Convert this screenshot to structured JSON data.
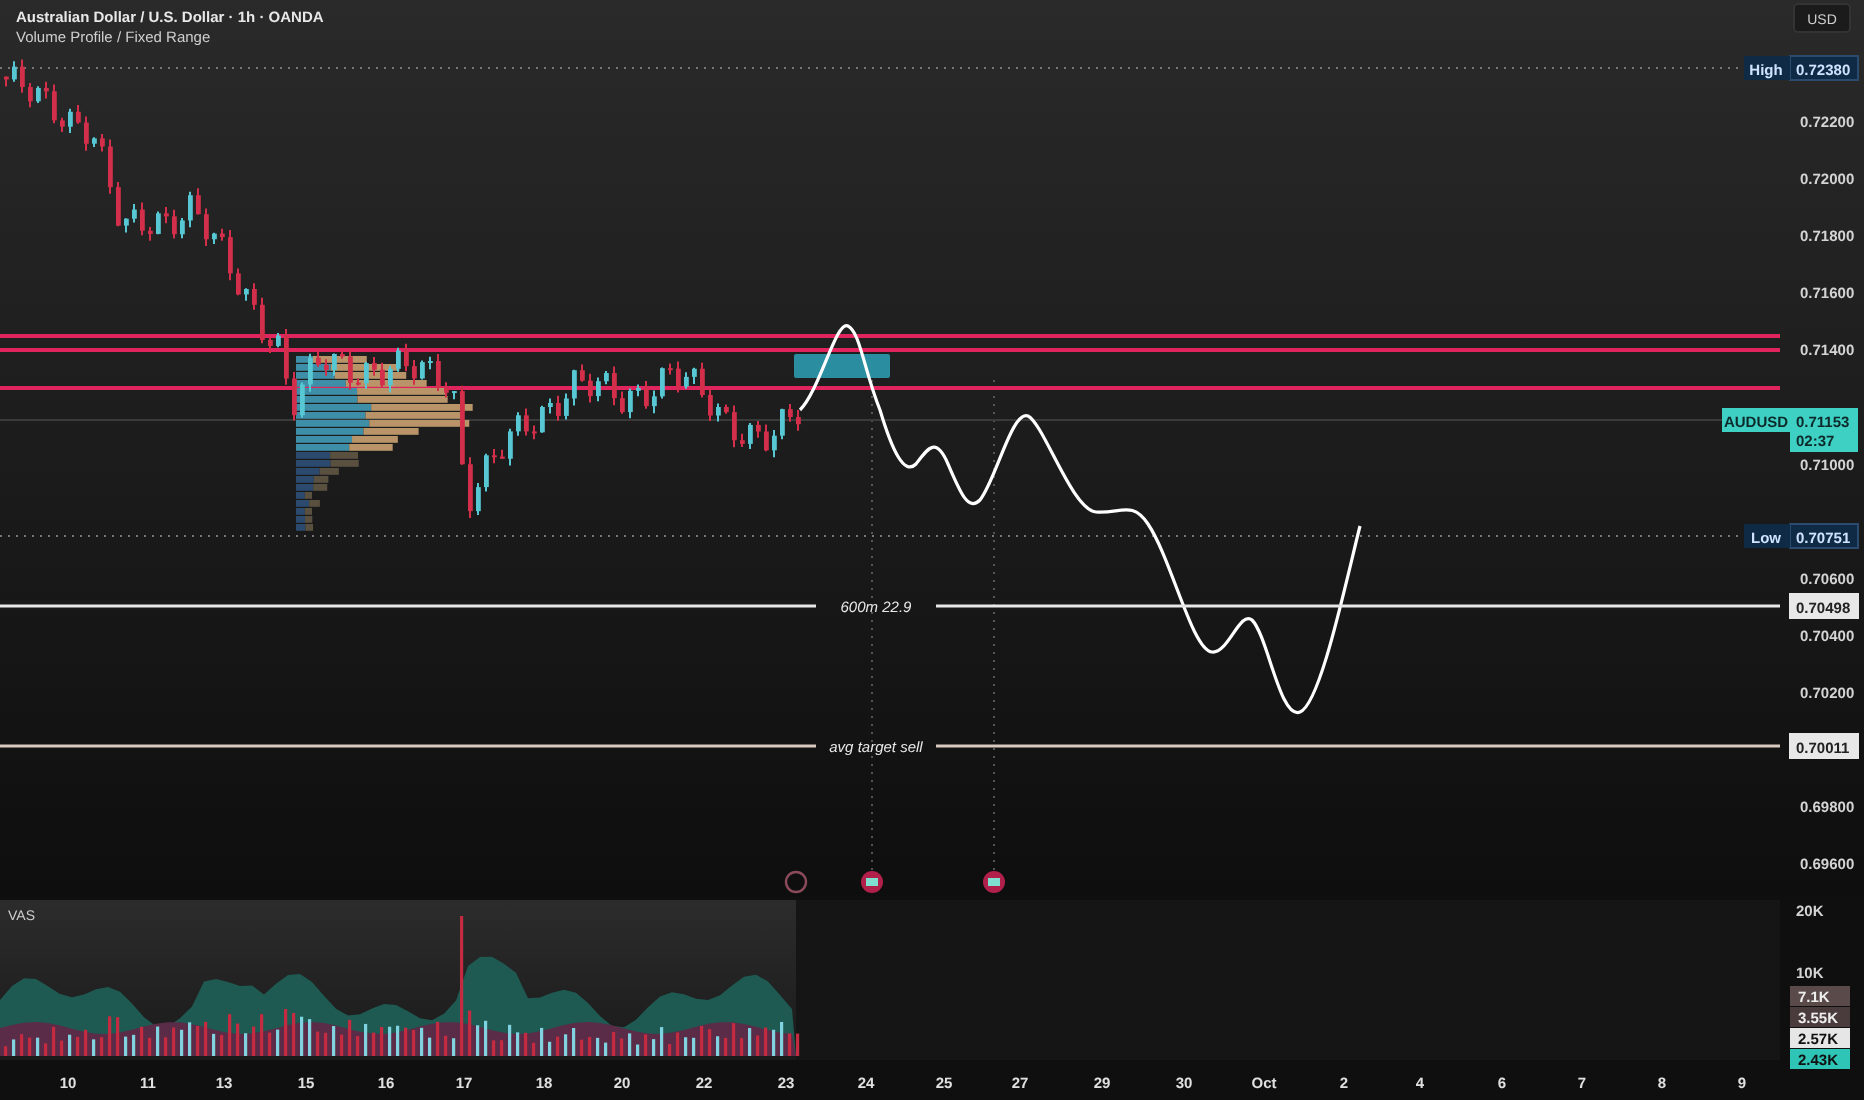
{
  "header": {
    "symbol_title": "Australian Dollar / U.S. Dollar · 1h · OANDA",
    "indicator": "Volume Profile / Fixed Range"
  },
  "currency_button": "USD",
  "price_scale": [
    "0.72200",
    "0.72000",
    "0.71800",
    "0.71600",
    "0.71400",
    "0.71000",
    "0.70600",
    "0.70400",
    "0.70200",
    "0.69800",
    "0.69600"
  ],
  "price_badges": [
    {
      "kind": "high",
      "caption": "High",
      "value": "0.72380"
    },
    {
      "kind": "last",
      "caption": "AUDUSD",
      "value": "0.71153",
      "countdown": "02:37"
    },
    {
      "kind": "low",
      "caption": "Low",
      "value": "0.70751"
    },
    {
      "kind": "line",
      "value": "0.70498"
    },
    {
      "kind": "line",
      "value": "0.70011"
    }
  ],
  "labeled_lines": [
    {
      "label": "600m 22.9"
    },
    {
      "label": "avg target sell"
    }
  ],
  "volume_pane": {
    "title": "VAS",
    "scale": [
      "20K",
      "10K"
    ],
    "badges": [
      {
        "value": "7.1K",
        "color": "#5a4a4a"
      },
      {
        "value": "3.55K",
        "color": "#4a3b3d"
      },
      {
        "value": "2.57K",
        "color": "#e6e6e6"
      },
      {
        "value": "2.43K",
        "color": "#2ec4b6"
      }
    ]
  },
  "time_axis": [
    "10",
    "11",
    "13",
    "15",
    "16",
    "17",
    "18",
    "20",
    "22",
    "23",
    "24",
    "25",
    "27",
    "29",
    "30",
    "Oct",
    "2",
    "4",
    "6",
    "7",
    "8",
    "9"
  ]
}
